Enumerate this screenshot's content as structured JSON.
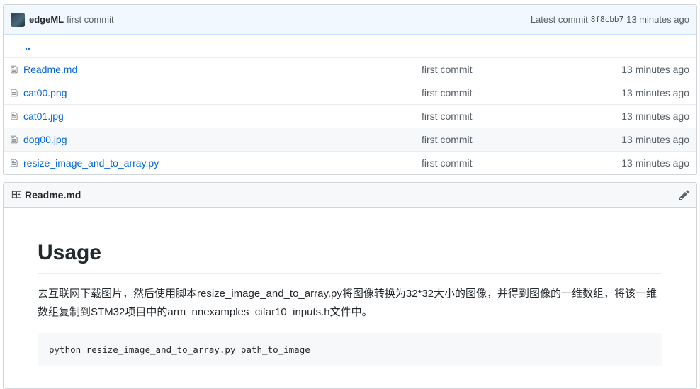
{
  "commit": {
    "author": "edgeML",
    "message": "first commit",
    "latest_label": "Latest commit",
    "sha": "8f8cbb7",
    "age": "13 minutes ago"
  },
  "parent_dir": "..",
  "files": [
    {
      "name": "Readme.md",
      "message": "first commit",
      "age": "13 minutes ago"
    },
    {
      "name": "cat00.png",
      "message": "first commit",
      "age": "13 minutes ago"
    },
    {
      "name": "cat01.jpg",
      "message": "first commit",
      "age": "13 minutes ago"
    },
    {
      "name": "dog00.jpg",
      "message": "first commit",
      "age": "13 minutes ago"
    },
    {
      "name": "resize_image_and_to_array.py",
      "message": "first commit",
      "age": "13 minutes ago"
    }
  ],
  "readme": {
    "header": "Readme.md",
    "heading": "Usage",
    "paragraph": "去互联网下载图片，然后使用脚本resize_image_and_to_array.py将图像转换为32*32大小的图像，并得到图像的一维数组，将该一维数组复制到STM32项目中的arm_nnexamples_cifar10_inputs.h文件中。",
    "code": "python resize_image_and_to_array.py path_to_image"
  },
  "colors": {
    "link": "#0366d6",
    "muted": "#586069",
    "commit_bg": "#f1f8ff"
  }
}
